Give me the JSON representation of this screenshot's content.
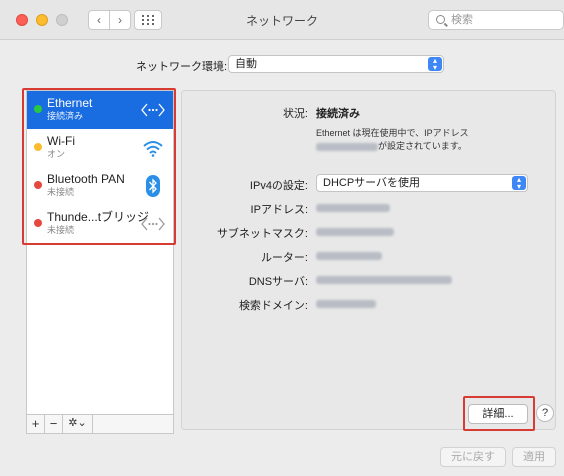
{
  "window": {
    "title": "ネットワーク",
    "search_placeholder": "検索"
  },
  "location": {
    "label": "ネットワーク環境:",
    "value": "自動"
  },
  "services": [
    {
      "name": "Ethernet",
      "status": "接続済み",
      "dot_color": "#28c840",
      "icon": "ethernet-icon",
      "selected": true
    },
    {
      "name": "Wi-Fi",
      "status": "オン",
      "dot_color": "#fdbc2e",
      "icon": "wifi-icon",
      "selected": false
    },
    {
      "name": "Bluetooth PAN",
      "status": "未接続",
      "dot_color": "#e5483f",
      "icon": "bluetooth-icon",
      "selected": false
    },
    {
      "name": "Thunde...tブリッジ",
      "status": "未接続",
      "dot_color": "#e5483f",
      "icon": "thunderbolt-bridge-icon",
      "selected": false
    }
  ],
  "sidebar_footer": {
    "add": "+",
    "remove": "−",
    "gear": "✲⌄"
  },
  "detail": {
    "status_label": "状況:",
    "status_value": "接続済み",
    "status_note_line1": "Ethernet は現在使用中で、IPアドレス",
    "status_note_line2": "が設定されています。",
    "ipv4_label": "IPv4の設定:",
    "ipv4_value": "DHCPサーバを使用",
    "ip_label": "IPアドレス:",
    "subnet_label": "サブネットマスク:",
    "router_label": "ルーター:",
    "dns_label": "DNSサーバ:",
    "search_domain_label": "検索ドメイン:",
    "advanced_button": "詳細...",
    "help_button": "?"
  },
  "footer": {
    "revert": "元に戻す",
    "apply": "適用"
  },
  "colors": {
    "selection": "#1a6de0",
    "highlight_box": "#d83a34",
    "accent": "#3f87f5"
  }
}
